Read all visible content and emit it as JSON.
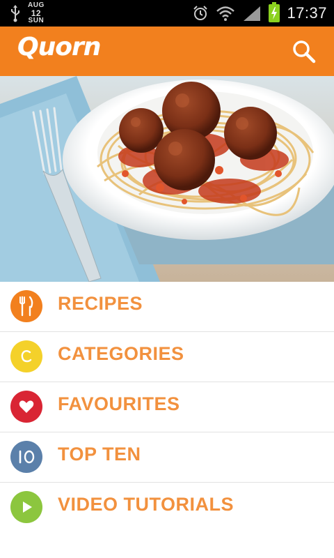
{
  "status_bar": {
    "date_month": "AUG",
    "date_day": "12",
    "date_weekday": "SUN",
    "time": "17:37",
    "icons": [
      "usb-icon",
      "alarm-icon",
      "wifi-icon",
      "signal-icon",
      "battery-charging-icon"
    ]
  },
  "app_bar": {
    "logo": "Quorn",
    "background": "#f2801e",
    "action_icon": "search-icon"
  },
  "hero": {
    "image": "spaghetti-and-meatballs-photo"
  },
  "menu": {
    "label_color": "#f2913e",
    "items": [
      {
        "label": "RECIPES",
        "icon": "fork-knife-icon",
        "color": "#f2801e"
      },
      {
        "label": "CATEGORIES",
        "icon": "c-letter-icon",
        "color": "#f4d12a"
      },
      {
        "label": "FAVOURITES",
        "icon": "heart-icon",
        "color": "#d92534"
      },
      {
        "label": "TOP TEN",
        "icon": "ten-icon",
        "color": "#5b80aa"
      },
      {
        "label": "VIDEO TUTORIALS",
        "icon": "play-icon",
        "color": "#8cc63e"
      }
    ]
  }
}
